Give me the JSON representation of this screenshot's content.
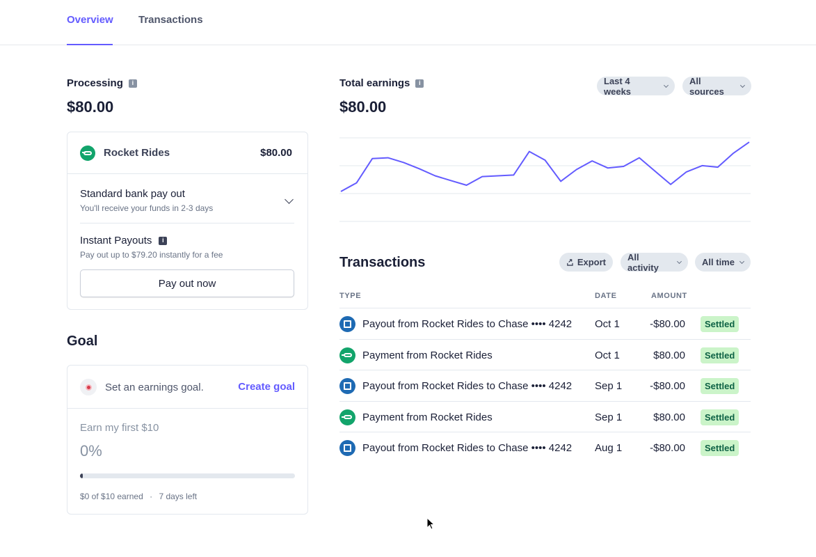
{
  "tabs": [
    {
      "label": "Overview",
      "active": true
    },
    {
      "label": "Transactions",
      "active": false
    }
  ],
  "processing": {
    "label": "Processing",
    "amount": "$80.00",
    "merchant": {
      "name": "Rocket Rides",
      "amount": "$80.00",
      "icon": "rocket-rides-logo"
    },
    "standard": {
      "title": "Standard bank pay out",
      "subtitle": "You'll receive your funds in 2-3 days"
    },
    "instant": {
      "title": "Instant Payouts",
      "subtitle": "Pay out up to $79.20 instantly for a fee"
    },
    "button_label": "Pay out now"
  },
  "goal": {
    "title": "Goal",
    "prompt": "Set an earnings goal.",
    "create_label": "Create goal",
    "name": "Earn my first $10",
    "percent_label": "0%",
    "progress": 0,
    "earned_text": "$0 of $10 earned",
    "separator": "·",
    "days_left": "7 days left"
  },
  "earnings": {
    "label": "Total earnings",
    "amount": "$80.00",
    "filters": {
      "period": "Last 4 weeks",
      "source": "All sources"
    }
  },
  "chart_data": {
    "type": "line",
    "title": "",
    "xlabel": "",
    "ylabel": "",
    "grid": true,
    "series": [
      {
        "values": [
          0,
          11,
          42,
          43,
          37,
          29,
          20,
          14,
          8,
          19,
          20,
          21,
          51,
          40,
          13,
          28,
          39,
          30,
          32,
          43,
          26,
          9,
          25,
          33,
          31,
          49,
          63
        ]
      }
    ],
    "ylim": [
      -40,
      80
    ],
    "color": "#635bff"
  },
  "transactions": {
    "title": "Transactions",
    "actions": {
      "export": "Export",
      "activity": "All activity",
      "time": "All time"
    },
    "columns": {
      "type": "TYPE",
      "date": "DATE",
      "amount": "AMOUNT"
    },
    "rows": [
      {
        "icon": "chase-bank-icon",
        "description": "Payout from Rocket Rides to Chase •••• 4242",
        "date": "Oct 1",
        "amount": "-$80.00",
        "status": "Settled"
      },
      {
        "icon": "rocket-rides-icon",
        "description": "Payment from Rocket Rides",
        "date": "Oct 1",
        "amount": "$80.00",
        "status": "Settled"
      },
      {
        "icon": "chase-bank-icon",
        "description": "Payout from Rocket Rides to Chase •••• 4242",
        "date": "Sep 1",
        "amount": "-$80.00",
        "status": "Settled"
      },
      {
        "icon": "rocket-rides-icon",
        "description": "Payment from Rocket Rides",
        "date": "Sep 1",
        "amount": "$80.00",
        "status": "Settled"
      },
      {
        "icon": "chase-bank-icon",
        "description": "Payout from Rocket Rides to Chase •••• 4242",
        "date": "Aug 1",
        "amount": "-$80.00",
        "status": "Settled"
      }
    ]
  },
  "colors": {
    "accent": "#635bff",
    "settled_bg": "#cbf4c9",
    "settled_text": "#0e6245",
    "chase": "#1e6ab3",
    "rocket_rides": "#12a46b"
  }
}
